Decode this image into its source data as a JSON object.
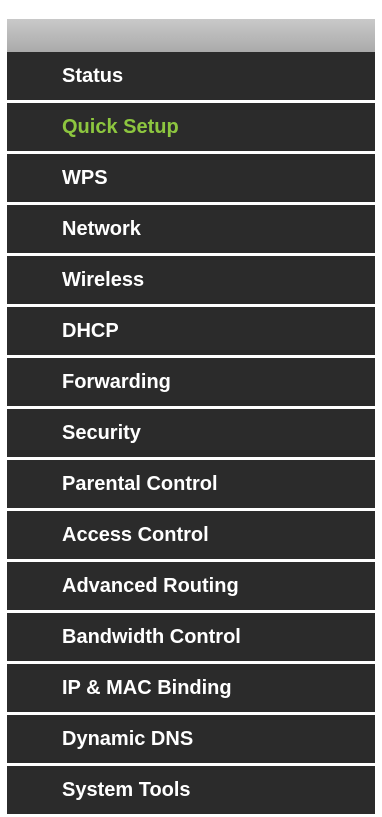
{
  "menu": {
    "active_color": "#8dc63f",
    "items": [
      {
        "label": "Status"
      },
      {
        "label": "Quick Setup",
        "active": true
      },
      {
        "label": "WPS"
      },
      {
        "label": "Network"
      },
      {
        "label": "Wireless"
      },
      {
        "label": "DHCP"
      },
      {
        "label": "Forwarding"
      },
      {
        "label": "Security"
      },
      {
        "label": "Parental Control"
      },
      {
        "label": "Access Control"
      },
      {
        "label": "Advanced Routing"
      },
      {
        "label": "Bandwidth Control"
      },
      {
        "label": "IP & MAC Binding"
      },
      {
        "label": "Dynamic DNS"
      },
      {
        "label": "System Tools"
      }
    ]
  }
}
